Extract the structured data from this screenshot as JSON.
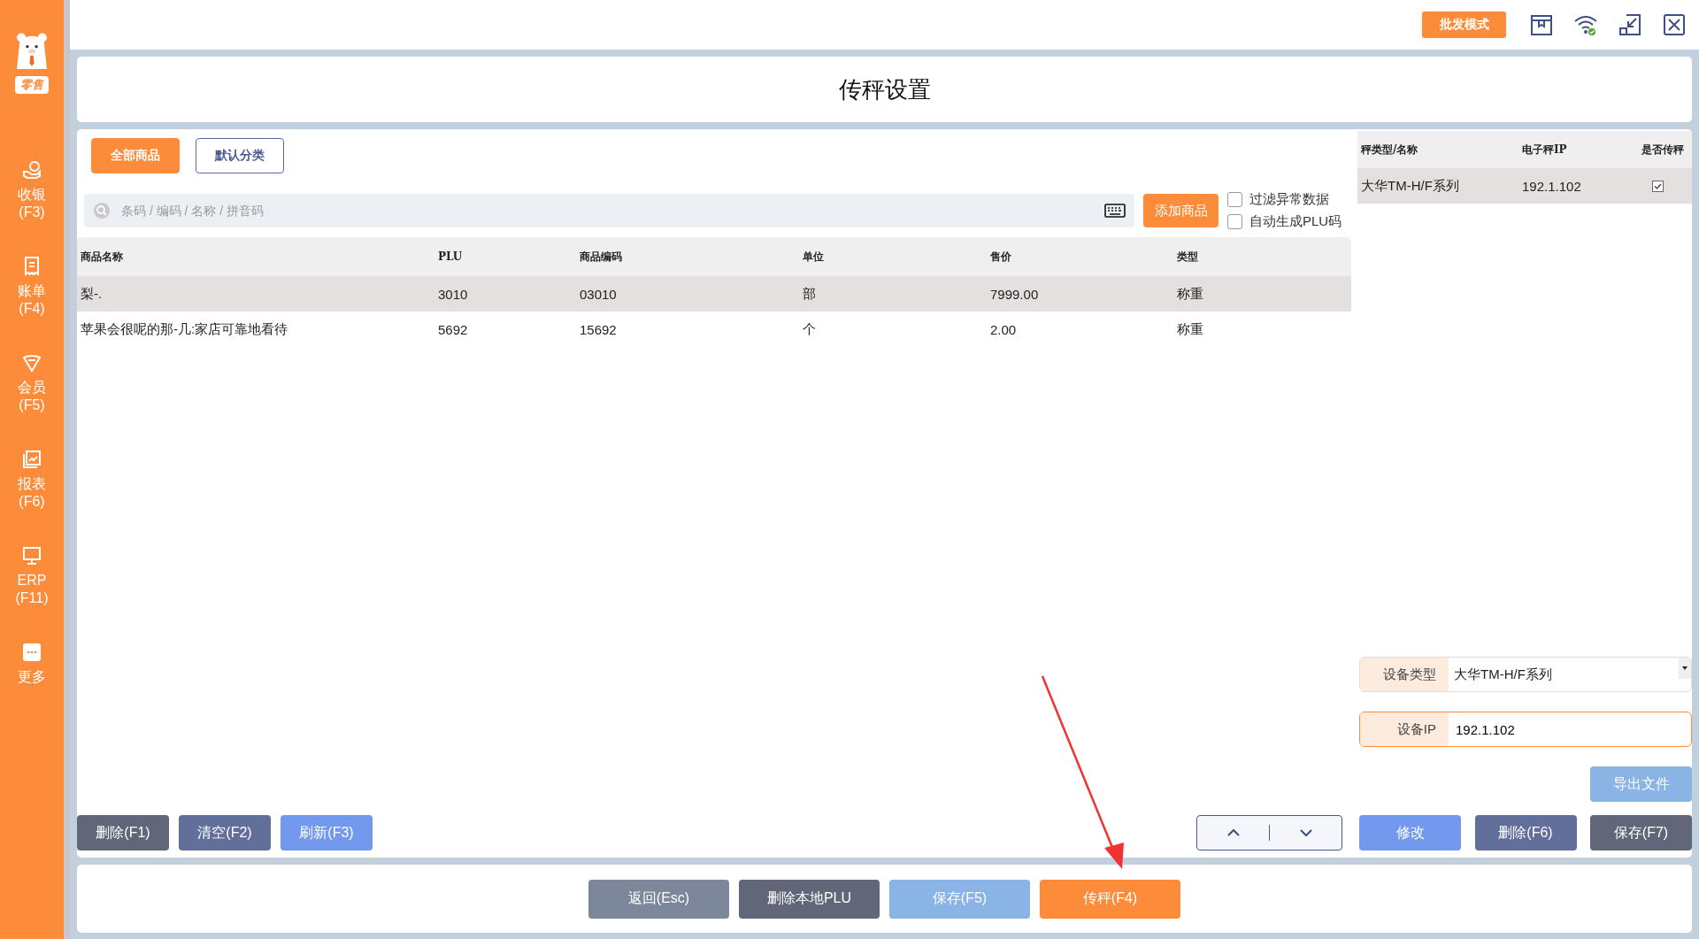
{
  "sidebar": {
    "logo_text": "零售",
    "items": [
      {
        "kind": "cashier",
        "label": "收银",
        "key": "(F3)"
      },
      {
        "kind": "bill",
        "label": "账单",
        "key": "(F4)"
      },
      {
        "kind": "member",
        "label": "会员",
        "key": "(F5)"
      },
      {
        "kind": "report",
        "label": "报表",
        "key": "(F6)"
      },
      {
        "kind": "erp",
        "label": "ERP",
        "key": "(F11)"
      },
      {
        "kind": "more",
        "label": "更多"
      }
    ]
  },
  "topbar": {
    "mode_button": "批发模式"
  },
  "title": "传秤设置",
  "category_tabs": [
    {
      "label": "全部商品",
      "selected": true
    },
    {
      "label": "默认分类",
      "selected": false
    }
  ],
  "search": {
    "placeholder": "条码 / 编码 / 名称 / 拼音码"
  },
  "add_button": "添加商品",
  "options": [
    {
      "label": "过滤异常数据",
      "checked": false
    },
    {
      "label": "自动生成PLU码",
      "checked": false
    }
  ],
  "products": {
    "columns": [
      "商品名称",
      "PLU",
      "商品编码",
      "单位",
      "售价",
      "类型"
    ],
    "rows": [
      {
        "cells": [
          "梨-.",
          "3010",
          "03010",
          "部",
          "7999.00",
          "称重"
        ],
        "selected": true
      },
      {
        "cells": [
          "苹果会很呢的那-几:家店可靠地看待",
          "5692",
          "15692",
          "个",
          "2.00",
          "称重"
        ],
        "selected": false
      }
    ]
  },
  "left_actions": [
    {
      "label": "删除(F1)",
      "kind": "dark"
    },
    {
      "label": "清空(F2)",
      "kind": "slate"
    },
    {
      "label": "刷新(F3)",
      "kind": "blue"
    }
  ],
  "scales": {
    "columns": [
      "秤类型/名称",
      "电子秤IP",
      "是否传秤"
    ],
    "rows": [
      {
        "name": "大华TM-H/F系列",
        "ip": "192.1.102",
        "transfer": true,
        "selected": true
      }
    ]
  },
  "device_type": {
    "label": "设备类型",
    "value": "大华TM-H/F系列"
  },
  "device_ip": {
    "label": "设备IP",
    "value": "192.1.102"
  },
  "export_button": {
    "label": "导出文件",
    "kind": "light"
  },
  "right_actions": [
    {
      "label": "修改",
      "kind": "blue"
    },
    {
      "label": "删除(F6)",
      "kind": "slate"
    },
    {
      "label": "保存(F7)",
      "kind": "dark"
    }
  ],
  "footer_actions": [
    {
      "label": "返回(Esc)",
      "kind": "grey"
    },
    {
      "label": "删除本地PLU",
      "kind": "dark"
    },
    {
      "label": "保存(F5)",
      "kind": "light"
    },
    {
      "label": "传秤(F4)",
      "kind": "orange"
    }
  ]
}
